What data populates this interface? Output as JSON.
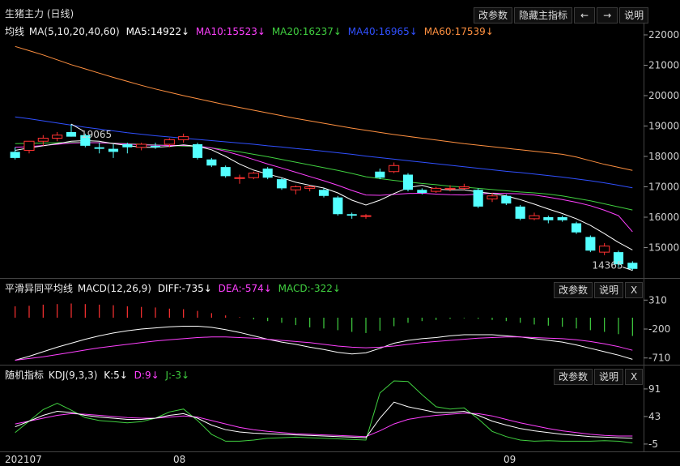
{
  "header": {
    "title": "生猪主力 (日线)",
    "buttons": [
      "改参数",
      "隐藏主指标",
      "←",
      "→",
      "说明"
    ]
  },
  "main": {
    "label": "均线",
    "params": "MA(5,10,20,40,60)",
    "ma5": "MA5:14922↓",
    "ma10": "MA10:15523↓",
    "ma20": "MA20:16237↓",
    "ma40": "MA40:16965↓",
    "ma60": "MA60:17539↓",
    "high_label": "19065",
    "low_label": "14365",
    "y_ticks": [
      "22000",
      "21000",
      "20000",
      "19000",
      "18000",
      "17000",
      "16000",
      "15000"
    ]
  },
  "macd": {
    "label": "平滑异同平均线",
    "params": "MACD(12,26,9)",
    "diff": "DIFF:-735↓",
    "dea": "DEA:-574↓",
    "macd": "MACD:-322↓",
    "buttons": [
      "改参数",
      "说明",
      "X"
    ],
    "y_ticks": [
      "310",
      "-200",
      "-710"
    ]
  },
  "kdj": {
    "label": "随机指标",
    "params": "KDJ(9,3,3)",
    "k": "K:5↓",
    "d": "D:9↓",
    "j": "J:-3↓",
    "buttons": [
      "改参数",
      "说明",
      "X"
    ],
    "y_ticks": [
      "91",
      "43",
      "-5"
    ]
  },
  "x_axis": {
    "labels": [
      "202107",
      "08",
      "09"
    ]
  },
  "colors": {
    "up": "#ff3232",
    "down": "#54ffff",
    "ma5": "#ffffff",
    "ma10": "#ff40ff",
    "ma20": "#40d040",
    "ma40": "#3050ff",
    "ma60": "#ff9040"
  },
  "chart_data": [
    {
      "type": "candlestick",
      "title": "生猪主力 (日线)",
      "ylim": [
        14000,
        22400
      ],
      "candles": [
        {
          "o": 18150,
          "h": 18300,
          "l": 17900,
          "c": 17950
        },
        {
          "o": 18200,
          "h": 18500,
          "l": 18100,
          "c": 18500
        },
        {
          "o": 18500,
          "h": 18700,
          "l": 18350,
          "c": 18600
        },
        {
          "o": 18600,
          "h": 18800,
          "l": 18500,
          "c": 18700
        },
        {
          "o": 18800,
          "h": 19065,
          "l": 18650,
          "c": 18650
        },
        {
          "o": 18700,
          "h": 18750,
          "l": 18300,
          "c": 18350
        },
        {
          "o": 18300,
          "h": 18450,
          "l": 18100,
          "c": 18250
        },
        {
          "o": 18250,
          "h": 18400,
          "l": 17950,
          "c": 18150
        },
        {
          "o": 18400,
          "h": 18450,
          "l": 18100,
          "c": 18300
        },
        {
          "o": 18300,
          "h": 18450,
          "l": 18200,
          "c": 18400
        },
        {
          "o": 18350,
          "h": 18450,
          "l": 18250,
          "c": 18300
        },
        {
          "o": 18400,
          "h": 18600,
          "l": 18300,
          "c": 18550
        },
        {
          "o": 18550,
          "h": 18750,
          "l": 18450,
          "c": 18650
        },
        {
          "o": 18400,
          "h": 18450,
          "l": 17900,
          "c": 17950
        },
        {
          "o": 17900,
          "h": 17950,
          "l": 17650,
          "c": 17700
        },
        {
          "o": 17650,
          "h": 17700,
          "l": 17300,
          "c": 17350
        },
        {
          "o": 17300,
          "h": 17400,
          "l": 17100,
          "c": 17300
        },
        {
          "o": 17300,
          "h": 17500,
          "l": 17250,
          "c": 17450
        },
        {
          "o": 17600,
          "h": 17650,
          "l": 17250,
          "c": 17300
        },
        {
          "o": 17250,
          "h": 17300,
          "l": 16900,
          "c": 16950
        },
        {
          "o": 16900,
          "h": 17050,
          "l": 16750,
          "c": 17000
        },
        {
          "o": 16950,
          "h": 17050,
          "l": 16850,
          "c": 17000
        },
        {
          "o": 16900,
          "h": 16950,
          "l": 16650,
          "c": 16700
        },
        {
          "o": 16650,
          "h": 16700,
          "l": 16050,
          "c": 16100
        },
        {
          "o": 16100,
          "h": 16150,
          "l": 15950,
          "c": 16050
        },
        {
          "o": 16050,
          "h": 16100,
          "l": 15950,
          "c": 16050
        },
        {
          "o": 17500,
          "h": 17600,
          "l": 17250,
          "c": 17300
        },
        {
          "o": 17500,
          "h": 17800,
          "l": 17450,
          "c": 17700
        },
        {
          "o": 17400,
          "h": 17450,
          "l": 16850,
          "c": 16900
        },
        {
          "o": 16900,
          "h": 16950,
          "l": 16750,
          "c": 16800
        },
        {
          "o": 16850,
          "h": 17000,
          "l": 16800,
          "c": 16950
        },
        {
          "o": 16950,
          "h": 17050,
          "l": 16850,
          "c": 16950
        },
        {
          "o": 16950,
          "h": 17100,
          "l": 16900,
          "c": 17000
        },
        {
          "o": 16900,
          "h": 16950,
          "l": 16300,
          "c": 16350
        },
        {
          "o": 16600,
          "h": 16800,
          "l": 16500,
          "c": 16700
        },
        {
          "o": 16700,
          "h": 16750,
          "l": 16400,
          "c": 16450
        },
        {
          "o": 16350,
          "h": 16400,
          "l": 15900,
          "c": 15950
        },
        {
          "o": 15950,
          "h": 16150,
          "l": 15900,
          "c": 16050
        },
        {
          "o": 16000,
          "h": 16050,
          "l": 15800,
          "c": 15900
        },
        {
          "o": 16000,
          "h": 16050,
          "l": 15850,
          "c": 15900
        },
        {
          "o": 15800,
          "h": 15850,
          "l": 15450,
          "c": 15500
        },
        {
          "o": 15350,
          "h": 15400,
          "l": 14850,
          "c": 14900
        },
        {
          "o": 14850,
          "h": 15150,
          "l": 14750,
          "c": 15050
        },
        {
          "o": 14850,
          "h": 14900,
          "l": 14365,
          "c": 14450
        },
        {
          "o": 14500,
          "h": 14550,
          "l": 14250,
          "c": 14300
        }
      ],
      "ma5": [
        18200,
        18280,
        18350,
        18420,
        18500,
        18520,
        18500,
        18420,
        18360,
        18300,
        18300,
        18330,
        18380,
        18330,
        18220,
        18000,
        17750,
        17550,
        17420,
        17300,
        17150,
        17050,
        16960,
        16800,
        16560,
        16400,
        16560,
        16780,
        16970,
        17050,
        16920,
        16900,
        16900,
        16830,
        16780,
        16700,
        16580,
        16430,
        16270,
        16120,
        15950,
        15730,
        15460,
        15170,
        14922
      ],
      "ma10": [
        18300,
        18320,
        18360,
        18400,
        18440,
        18450,
        18450,
        18430,
        18410,
        18380,
        18370,
        18360,
        18360,
        18340,
        18280,
        18170,
        18040,
        17900,
        17750,
        17620,
        17480,
        17340,
        17200,
        17050,
        16880,
        16730,
        16720,
        16750,
        16780,
        16790,
        16760,
        16740,
        16730,
        16760,
        16790,
        16780,
        16770,
        16730,
        16660,
        16580,
        16490,
        16380,
        16230,
        16050,
        15523
      ],
      "ma20": [
        18420,
        18430,
        18440,
        18450,
        18460,
        18460,
        18450,
        18440,
        18420,
        18400,
        18380,
        18360,
        18340,
        18320,
        18280,
        18220,
        18150,
        18070,
        17990,
        17900,
        17810,
        17720,
        17630,
        17540,
        17440,
        17330,
        17270,
        17210,
        17160,
        17110,
        17070,
        17020,
        16990,
        16950,
        16910,
        16870,
        16830,
        16800,
        16760,
        16700,
        16620,
        16540,
        16440,
        16340,
        16237
      ],
      "ma40": [
        19300,
        19240,
        19170,
        19100,
        19030,
        18960,
        18900,
        18840,
        18780,
        18730,
        18680,
        18640,
        18600,
        18560,
        18520,
        18480,
        18440,
        18400,
        18350,
        18310,
        18260,
        18220,
        18170,
        18120,
        18070,
        18010,
        17960,
        17910,
        17860,
        17810,
        17760,
        17710,
        17660,
        17610,
        17560,
        17510,
        17470,
        17420,
        17370,
        17320,
        17260,
        17200,
        17130,
        17050,
        16965
      ],
      "ma60": [
        21620,
        21480,
        21340,
        21180,
        21020,
        20880,
        20740,
        20600,
        20470,
        20340,
        20220,
        20110,
        20000,
        19900,
        19800,
        19700,
        19610,
        19520,
        19430,
        19340,
        19250,
        19170,
        19090,
        19010,
        18930,
        18860,
        18790,
        18720,
        18660,
        18600,
        18540,
        18480,
        18420,
        18370,
        18320,
        18270,
        18220,
        18170,
        18120,
        18070,
        17980,
        17860,
        17740,
        17640,
        17539
      ]
    },
    {
      "type": "bar+line",
      "title": "MACD(12,26,9)",
      "ylim": [
        -800,
        400
      ],
      "macd": [
        200,
        210,
        230,
        240,
        250,
        240,
        230,
        220,
        200,
        190,
        180,
        160,
        150,
        120,
        80,
        40,
        10,
        -30,
        -60,
        -90,
        -130,
        -170,
        -190,
        -220,
        -250,
        -270,
        -230,
        -150,
        -90,
        -60,
        -40,
        -20,
        -10,
        -20,
        -40,
        -60,
        -90,
        -120,
        -140,
        -160,
        -190,
        -220,
        -250,
        -290,
        -322
      ],
      "diff": [
        -750,
        -680,
        -600,
        -520,
        -450,
        -380,
        -320,
        -270,
        -230,
        -200,
        -180,
        -160,
        -150,
        -150,
        -170,
        -210,
        -260,
        -320,
        -380,
        -430,
        -470,
        -520,
        -560,
        -610,
        -640,
        -620,
        -540,
        -450,
        -400,
        -370,
        -350,
        -320,
        -300,
        -300,
        -300,
        -320,
        -340,
        -370,
        -400,
        -430,
        -480,
        -540,
        -600,
        -660,
        -735
      ],
      "dea": [
        -750,
        -720,
        -690,
        -650,
        -610,
        -570,
        -530,
        -500,
        -470,
        -440,
        -410,
        -390,
        -370,
        -350,
        -340,
        -340,
        -350,
        -360,
        -380,
        -400,
        -420,
        -440,
        -470,
        -500,
        -520,
        -530,
        -520,
        -500,
        -470,
        -440,
        -420,
        -400,
        -380,
        -360,
        -350,
        -340,
        -340,
        -350,
        -360,
        -370,
        -390,
        -420,
        -460,
        -510,
        -574
      ]
    },
    {
      "type": "line",
      "title": "KDJ(9,3,3)",
      "ylim": [
        -15,
        105
      ],
      "k": [
        25,
        35,
        45,
        52,
        50,
        45,
        42,
        40,
        38,
        38,
        40,
        45,
        48,
        40,
        28,
        20,
        16,
        14,
        13,
        12,
        11,
        10,
        9,
        8,
        7,
        6,
        40,
        68,
        60,
        55,
        50,
        50,
        52,
        45,
        35,
        28,
        22,
        18,
        15,
        12,
        10,
        8,
        7,
        6,
        5
      ],
      "d": [
        30,
        35,
        40,
        45,
        48,
        47,
        45,
        43,
        41,
        40,
        40,
        42,
        44,
        42,
        36,
        30,
        24,
        20,
        17,
        15,
        13,
        12,
        11,
        10,
        9,
        8,
        18,
        30,
        38,
        42,
        45,
        47,
        49,
        48,
        44,
        38,
        32,
        27,
        22,
        18,
        15,
        12,
        10,
        9,
        9
      ],
      "j": [
        15,
        35,
        55,
        66,
        54,
        41,
        36,
        34,
        32,
        34,
        40,
        51,
        56,
        36,
        12,
        0,
        0,
        2,
        5,
        6,
        7,
        6,
        5,
        4,
        3,
        2,
        84,
        144,
        104,
        81,
        60,
        56,
        58,
        39,
        17,
        8,
        2,
        0,
        1,
        0,
        0,
        0,
        1,
        0,
        -3
      ]
    }
  ]
}
